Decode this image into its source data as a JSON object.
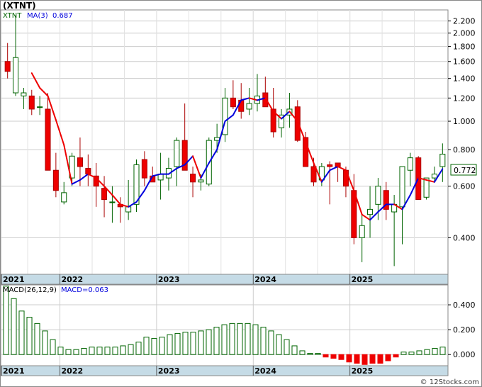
{
  "header": {
    "title": "(XTNT)"
  },
  "legend": {
    "symbol": "XTNT",
    "ma_label": "MA(3)",
    "ma_value": "0.687"
  },
  "macd_legend": {
    "label": "MACD(26,12,9)",
    "value": "MACD=0.063"
  },
  "price_tag": "0.772",
  "watermark": "© 12Stocks.com",
  "colors": {
    "up_fill": "#ffffff",
    "up_stroke": "#006400",
    "down_fill": "#ee0000",
    "down_stroke": "#aa0000",
    "ma_up": "#0000dd",
    "ma_down": "#ee0000",
    "macd_pos": "#006400",
    "macd_neg": "#ee0000",
    "axis_band": "#c5dbe6",
    "grid": "#cccccc"
  },
  "chart_data": [
    {
      "type": "candlestick",
      "title": "(XTNT)",
      "scale": "log",
      "ylim": [
        0.3,
        2.4
      ],
      "y_ticks": [
        "2.200",
        "2.000",
        "1.800",
        "1.600",
        "1.400",
        "1.200",
        "1.000",
        "0.800",
        "0.600",
        "0.400"
      ],
      "x_ticks": [
        "2021",
        "2022",
        "2023",
        "2024",
        "2025"
      ],
      "grid": true,
      "ohlc": [
        [
          1.6,
          1.85,
          1.4,
          1.48
        ],
        [
          1.25,
          2.3,
          1.22,
          1.65
        ],
        [
          1.22,
          1.3,
          1.1,
          1.25
        ],
        [
          1.22,
          1.28,
          1.05,
          1.1
        ],
        [
          1.12,
          1.22,
          1.05,
          1.12
        ],
        [
          1.1,
          1.25,
          0.7,
          0.68
        ],
        [
          0.68,
          0.78,
          0.55,
          0.58
        ],
        [
          0.53,
          0.62,
          0.52,
          0.57
        ],
        [
          0.64,
          0.78,
          0.6,
          0.76
        ],
        [
          0.75,
          0.88,
          0.6,
          0.7
        ],
        [
          0.69,
          0.77,
          0.6,
          0.66
        ],
        [
          0.65,
          0.72,
          0.51,
          0.6
        ],
        [
          0.59,
          0.65,
          0.47,
          0.54
        ],
        [
          0.53,
          0.6,
          0.45,
          0.53
        ],
        [
          0.52,
          0.55,
          0.45,
          0.51
        ],
        [
          0.49,
          0.63,
          0.46,
          0.51
        ],
        [
          0.52,
          0.74,
          0.49,
          0.71
        ],
        [
          0.74,
          0.79,
          0.6,
          0.64
        ],
        [
          0.65,
          0.7,
          0.62,
          0.62
        ],
        [
          0.63,
          0.78,
          0.54,
          0.66
        ],
        [
          0.64,
          0.75,
          0.58,
          0.69
        ],
        [
          0.7,
          0.88,
          0.6,
          0.86
        ],
        [
          0.86,
          1.15,
          0.7,
          0.68
        ],
        [
          0.66,
          0.7,
          0.55,
          0.62
        ],
        [
          0.62,
          0.66,
          0.58,
          0.63
        ],
        [
          0.61,
          0.88,
          0.6,
          0.86
        ],
        [
          0.86,
          0.98,
          0.78,
          0.88
        ],
        [
          0.9,
          1.3,
          0.85,
          1.2
        ],
        [
          1.2,
          1.38,
          1.1,
          1.12
        ],
        [
          1.18,
          1.35,
          1.02,
          1.08
        ],
        [
          1.1,
          1.3,
          1.05,
          1.15
        ],
        [
          1.15,
          1.45,
          1.08,
          1.22
        ],
        [
          1.25,
          1.42,
          1.2,
          1.12
        ],
        [
          1.1,
          1.3,
          0.88,
          0.92
        ],
        [
          0.95,
          1.1,
          0.88,
          1.05
        ],
        [
          1.05,
          1.25,
          0.95,
          1.1
        ],
        [
          1.12,
          1.18,
          0.85,
          0.86
        ],
        [
          0.88,
          0.92,
          0.72,
          0.7
        ],
        [
          0.7,
          0.75,
          0.6,
          0.62
        ],
        [
          0.63,
          0.72,
          0.6,
          0.7
        ],
        [
          0.71,
          0.73,
          0.52,
          0.7
        ],
        [
          0.72,
          0.7,
          0.62,
          0.7
        ],
        [
          0.68,
          0.7,
          0.55,
          0.6
        ],
        [
          0.58,
          0.66,
          0.38,
          0.4
        ],
        [
          0.4,
          0.48,
          0.33,
          0.44
        ],
        [
          0.48,
          0.6,
          0.4,
          0.5
        ],
        [
          0.52,
          0.64,
          0.46,
          0.6
        ],
        [
          0.58,
          0.62,
          0.46,
          0.5
        ],
        [
          0.49,
          0.56,
          0.32,
          0.52
        ],
        [
          0.51,
          0.68,
          0.38,
          0.7
        ],
        [
          0.68,
          0.78,
          0.6,
          0.75
        ],
        [
          0.75,
          0.76,
          0.55,
          0.54
        ],
        [
          0.55,
          0.64,
          0.54,
          0.64
        ],
        [
          0.64,
          0.7,
          0.62,
          0.66
        ],
        [
          0.7,
          0.84,
          0.62,
          0.772
        ]
      ],
      "ma3": [
        null,
        null,
        null,
        1.46,
        1.3,
        1.22,
        1.01,
        0.83,
        0.61,
        0.63,
        0.66,
        0.64,
        0.6,
        0.56,
        0.52,
        0.51,
        0.53,
        0.58,
        0.65,
        0.66,
        0.66,
        0.69,
        0.71,
        0.76,
        0.64,
        0.72,
        0.8,
        1.0,
        1.05,
        1.18,
        1.2,
        1.18,
        1.2,
        1.08,
        1.02,
        1.08,
        1.0,
        0.85,
        0.72,
        0.62,
        0.68,
        0.7,
        0.68,
        0.58,
        0.48,
        0.46,
        0.49,
        0.52,
        0.52,
        0.5,
        0.56,
        0.64,
        0.63,
        0.62,
        0.687
      ]
    },
    {
      "type": "bar",
      "title": "MACD(26,12,9)",
      "ylim": [
        -0.09,
        0.56
      ],
      "y_ticks": [
        "0.400",
        "0.200",
        "0.000"
      ],
      "x_ticks": [
        "2021",
        "2022",
        "2023",
        "2024",
        "2025"
      ],
      "values": [
        0.55,
        0.45,
        0.35,
        0.3,
        0.25,
        0.19,
        0.12,
        0.06,
        0.04,
        0.04,
        0.05,
        0.06,
        0.06,
        0.06,
        0.06,
        0.07,
        0.08,
        0.1,
        0.14,
        0.13,
        0.14,
        0.16,
        0.17,
        0.18,
        0.18,
        0.19,
        0.2,
        0.22,
        0.24,
        0.25,
        0.25,
        0.25,
        0.24,
        0.22,
        0.19,
        0.16,
        0.12,
        0.07,
        0.03,
        0.01,
        0.01,
        -0.02,
        -0.03,
        -0.04,
        -0.06,
        -0.07,
        -0.08,
        -0.07,
        -0.07,
        -0.05,
        -0.02,
        0.02,
        0.02,
        0.03,
        0.04,
        0.05,
        0.06
      ]
    }
  ]
}
